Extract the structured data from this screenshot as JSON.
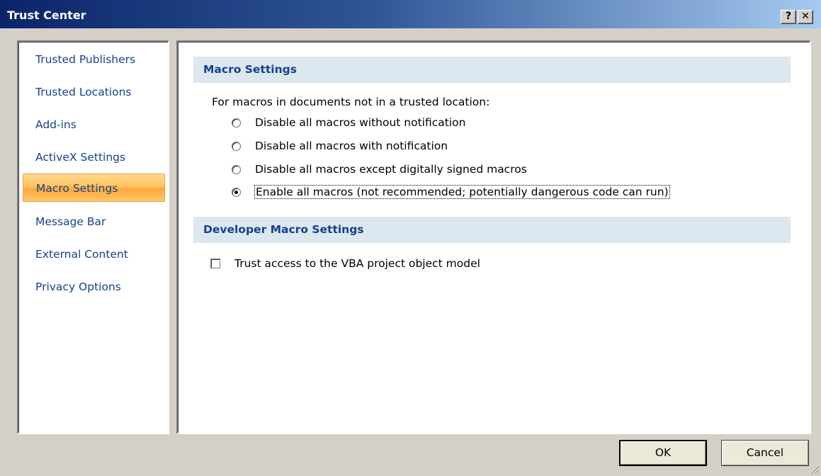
{
  "window": {
    "title": "Trust Center",
    "help_label": "?",
    "close_label": "✕"
  },
  "sidebar": {
    "items": [
      {
        "label": "Trusted Publishers",
        "selected": false
      },
      {
        "label": "Trusted Locations",
        "selected": false
      },
      {
        "label": "Add-ins",
        "selected": false
      },
      {
        "label": "ActiveX Settings",
        "selected": false
      },
      {
        "label": "Macro Settings",
        "selected": true
      },
      {
        "label": "Message Bar",
        "selected": false
      },
      {
        "label": "External Content",
        "selected": false
      },
      {
        "label": "Privacy Options",
        "selected": false
      }
    ]
  },
  "macro_settings": {
    "header": "Macro Settings",
    "description": "For macros in documents not in a trusted location:",
    "options": [
      {
        "label": "Disable all macros without notification",
        "checked": false
      },
      {
        "label": "Disable all macros with notification",
        "checked": false
      },
      {
        "label": "Disable all macros except digitally signed macros",
        "checked": false
      },
      {
        "label": "Enable all macros (not recommended; potentially dangerous code can run)",
        "checked": true
      }
    ]
  },
  "developer_settings": {
    "header": "Developer Macro Settings",
    "trust_vba_label": "Trust access to the VBA project object model",
    "trust_vba_checked": false
  },
  "buttons": {
    "ok": "OK",
    "cancel": "Cancel"
  },
  "colors": {
    "title_gradient_start": "#0a246a",
    "title_gradient_end": "#a6caf0",
    "nav_text": "#15428b",
    "selected_item": "#ffc460",
    "section_header_bg": "#dde7ef"
  }
}
